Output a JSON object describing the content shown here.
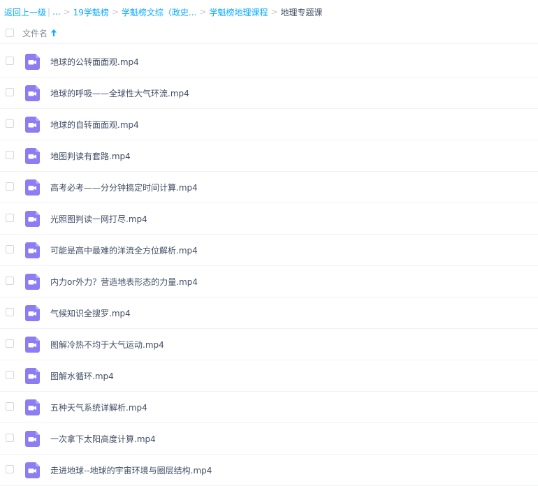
{
  "breadcrumb": {
    "back_label": "返回上一级",
    "pipe": "|",
    "ellipsis": "...",
    "sep": ">",
    "items": [
      "19学魁榜",
      "学魁榜文综（政史...",
      "学魁榜地理课程"
    ],
    "current": "地理专题课"
  },
  "header": {
    "file_name_label": "文件名",
    "sort_icon": "arrow-up-icon"
  },
  "colors": {
    "link": "#09aaff",
    "video_icon": "#8c7df2",
    "text": "#424e67"
  },
  "files": [
    {
      "name": "地球的公转面面观.mp4",
      "icon": "video-file-icon"
    },
    {
      "name": "地球的呼吸——全球性大气环流.mp4",
      "icon": "video-file-icon"
    },
    {
      "name": "地球的自转面面观.mp4",
      "icon": "video-file-icon"
    },
    {
      "name": "地图判读有套路.mp4",
      "icon": "video-file-icon"
    },
    {
      "name": "高考必考——分分钟搞定时间计算.mp4",
      "icon": "video-file-icon"
    },
    {
      "name": "光照图判读一网打尽.mp4",
      "icon": "video-file-icon"
    },
    {
      "name": "可能是高中最难的洋流全方位解析.mp4",
      "icon": "video-file-icon"
    },
    {
      "name": "内力or外力？营造地表形态的力量.mp4",
      "icon": "video-file-icon"
    },
    {
      "name": "气候知识全搜罗.mp4",
      "icon": "video-file-icon"
    },
    {
      "name": "图解冷热不均于大气运动.mp4",
      "icon": "video-file-icon"
    },
    {
      "name": "图解水循环.mp4",
      "icon": "video-file-icon"
    },
    {
      "name": "五种天气系统详解析.mp4",
      "icon": "video-file-icon"
    },
    {
      "name": "一次拿下太阳高度计算.mp4",
      "icon": "video-file-icon"
    },
    {
      "name": "走进地球--地球的宇宙环境与圈层结构.mp4",
      "icon": "video-file-icon"
    }
  ]
}
